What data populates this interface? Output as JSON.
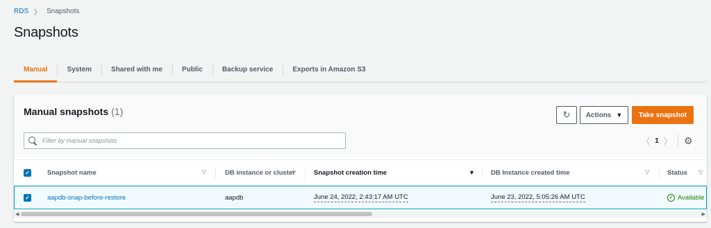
{
  "breadcrumb": {
    "root": "RDS",
    "separator": "〉",
    "current": "Snapshots"
  },
  "page_title": "Snapshots",
  "tabs": [
    {
      "label": "Manual",
      "active": true
    },
    {
      "label": "System",
      "active": false
    },
    {
      "label": "Shared with me",
      "active": false
    },
    {
      "label": "Public",
      "active": false
    },
    {
      "label": "Backup service",
      "active": false
    },
    {
      "label": "Exports in Amazon S3",
      "active": false
    }
  ],
  "panel": {
    "title": "Manual snapshots",
    "count": "(1)",
    "refresh_icon": "↻",
    "actions_label": "Actions",
    "actions_caret": "▼",
    "primary_label": "Take snapshot",
    "search_placeholder": "Filter by manual snapshots",
    "pager": {
      "prev": "〈",
      "page": "1",
      "next": "〉",
      "settings_icon": "⚙"
    }
  },
  "table": {
    "select_all_checked": true,
    "checkbox_glyph": "✓",
    "columns": [
      {
        "label": "Snapshot name",
        "sort": "▽"
      },
      {
        "label": "DB instance or cluster",
        "sort": "▽"
      },
      {
        "label": "Snapshot creation time",
        "sort": "▼"
      },
      {
        "label": "DB Instance created time",
        "sort": "▽"
      },
      {
        "label": "Status",
        "sort": "▽"
      }
    ],
    "rows": [
      {
        "checked": true,
        "snapshot_name": "aapdb-snap-before-restore",
        "db_instance": "aapdb",
        "snapshot_creation_time": "June 24, 2022, 2:43:17 AM UTC",
        "db_instance_created_time": "June 23, 2022, 5:05:26 AM UTC",
        "status": "Available",
        "status_icon": "✓"
      }
    ]
  },
  "scrollbar": {
    "left_arrow": "◀",
    "right_arrow": "▶",
    "thumb_fraction": 0.52
  },
  "colors": {
    "accent": "#ec7211",
    "link": "#0073bb",
    "success": "#1d8102",
    "selected_row_bg": "#f1faff",
    "selected_row_border": "#00a1c9"
  }
}
